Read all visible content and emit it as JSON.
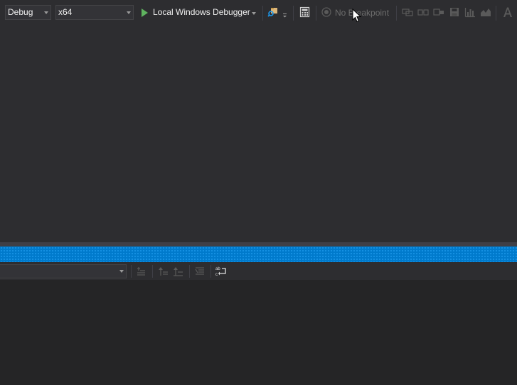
{
  "toolbar": {
    "configuration": {
      "value": "Debug"
    },
    "platform": {
      "value": "x64"
    },
    "debugger": {
      "label": "Local Windows Debugger"
    },
    "breakpoint": {
      "label": "No Breakpoint"
    },
    "icons": [
      "find-in-files-icon",
      "overflow-icon",
      "calculator-icon",
      "breakpoint-target-icon",
      "link-icon",
      "layers-icon",
      "frames-icon",
      "save-icon",
      "chart-icon",
      "area-chart-icon",
      "font-icon"
    ]
  },
  "output_panel": {
    "source_value": "",
    "icons": [
      "find-message-icon",
      "previous-message-icon",
      "next-message-icon",
      "clear-all-icon",
      "word-wrap-icon"
    ]
  },
  "colors": {
    "background": "#2d2d30",
    "accent": "#007acc",
    "play_green": "#5fb35f"
  }
}
